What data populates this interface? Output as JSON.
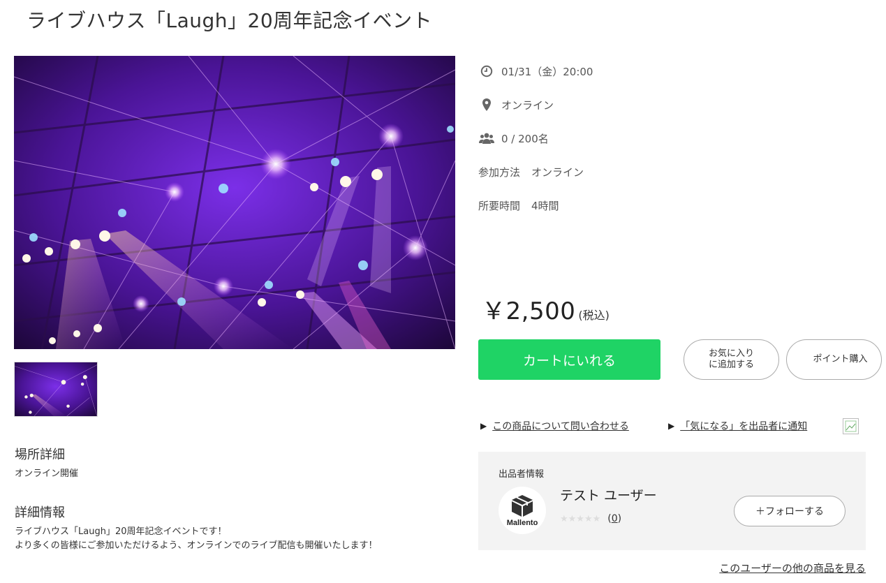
{
  "title": "ライブハウス「Laugh」20周年記念イベント",
  "images": {
    "main_alt": "live-stage-lights",
    "thumbnail_alt": "live-stage-lights"
  },
  "place_details": {
    "heading": "場所詳細",
    "text": "オンライン開催"
  },
  "details": {
    "heading": "詳細情報",
    "line1": "ライブハウス「Laugh」20周年記念イベントです！",
    "line2": "より多くの皆様にご参加いただけるよう、オンラインでのライブ配信も開催いたします！"
  },
  "event_info": {
    "datetime": "01/31（金）20:00",
    "location": "オンライン",
    "capacity": "0 / 200名",
    "participation_label": "参加方法",
    "participation_value": "オンライン",
    "duration_label": "所要時間",
    "duration_value": "4時間",
    "icons": [
      "clock-icon",
      "map-pin-icon",
      "users-icon"
    ]
  },
  "price": {
    "amount": "￥2,500",
    "tax_note": "(税込)"
  },
  "buttons": {
    "cart": "カートにいれる",
    "favorite_line1": "お気に入り",
    "favorite_line2": "に追加する",
    "point_purchase": "ポイント購入"
  },
  "links": {
    "inquiry": "この商品について問い合わせる",
    "notify": "「気になる」を出品者に通知"
  },
  "seller": {
    "label": "出品者情報",
    "logo_text": "Mallento",
    "name": "テスト ユーザー",
    "rating_count": "0",
    "follow": "＋フォローする",
    "other_items": "このユーザーの他の商品を見る"
  },
  "colors": {
    "cart_button": "#1fd365",
    "seller_box_bg": "#f3f3f3",
    "stage_purple": "#6a1fd0"
  }
}
